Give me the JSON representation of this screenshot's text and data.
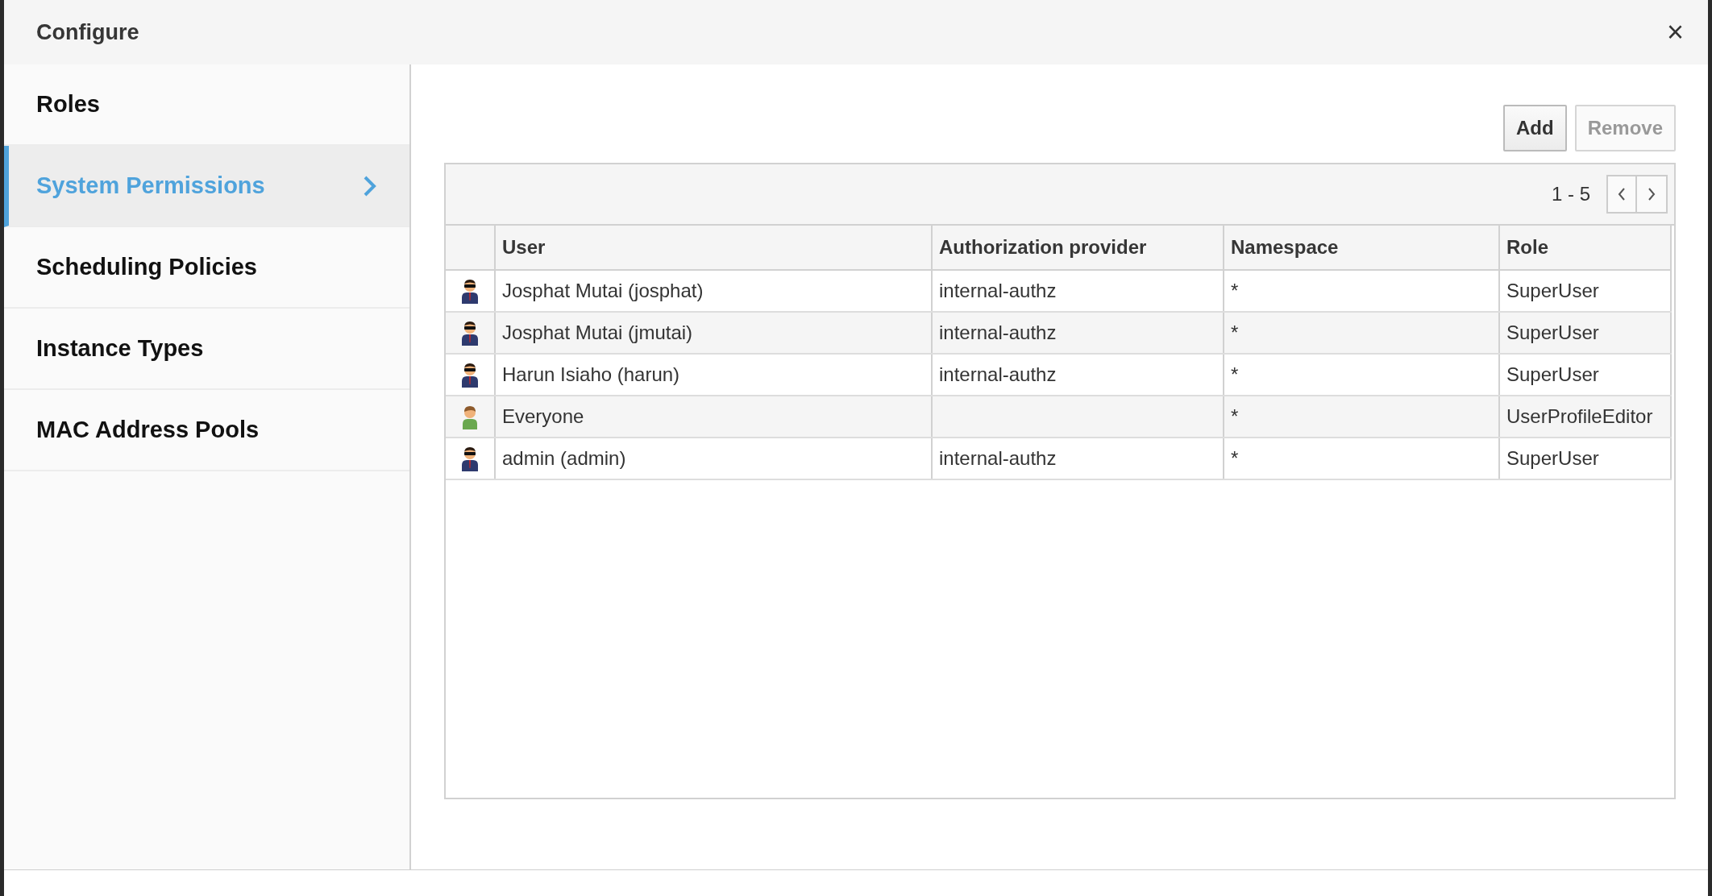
{
  "dialog": {
    "title": "Configure",
    "close": "×"
  },
  "sidebar": {
    "items": [
      {
        "label": "Roles",
        "selected": false
      },
      {
        "label": "System Permissions",
        "selected": true
      },
      {
        "label": "Scheduling Policies",
        "selected": false
      },
      {
        "label": "Instance Types",
        "selected": false
      },
      {
        "label": "MAC Address Pools",
        "selected": false
      }
    ]
  },
  "toolbar": {
    "buttons": [
      {
        "label": "Add",
        "disabled": false
      },
      {
        "label": "Remove",
        "disabled": true
      }
    ]
  },
  "pager": {
    "range": "1 - 5"
  },
  "table": {
    "columns": [
      "User",
      "Authorization provider",
      "Namespace",
      "Role"
    ],
    "rows": [
      {
        "kind": "user",
        "user": "Josphat Mutai (josphat)",
        "provider": "internal-authz",
        "namespace": "*",
        "role": "SuperUser"
      },
      {
        "kind": "user",
        "user": "Josphat Mutai (jmutai)",
        "provider": "internal-authz",
        "namespace": "*",
        "role": "SuperUser"
      },
      {
        "kind": "user",
        "user": "Harun Isiaho (harun)",
        "provider": "internal-authz",
        "namespace": "*",
        "role": "SuperUser"
      },
      {
        "kind": "group",
        "user": "Everyone",
        "provider": "",
        "namespace": "*",
        "role": "UserProfileEditor"
      },
      {
        "kind": "user",
        "user": "admin (admin)",
        "provider": "internal-authz",
        "namespace": "*",
        "role": "SuperUser"
      }
    ]
  }
}
